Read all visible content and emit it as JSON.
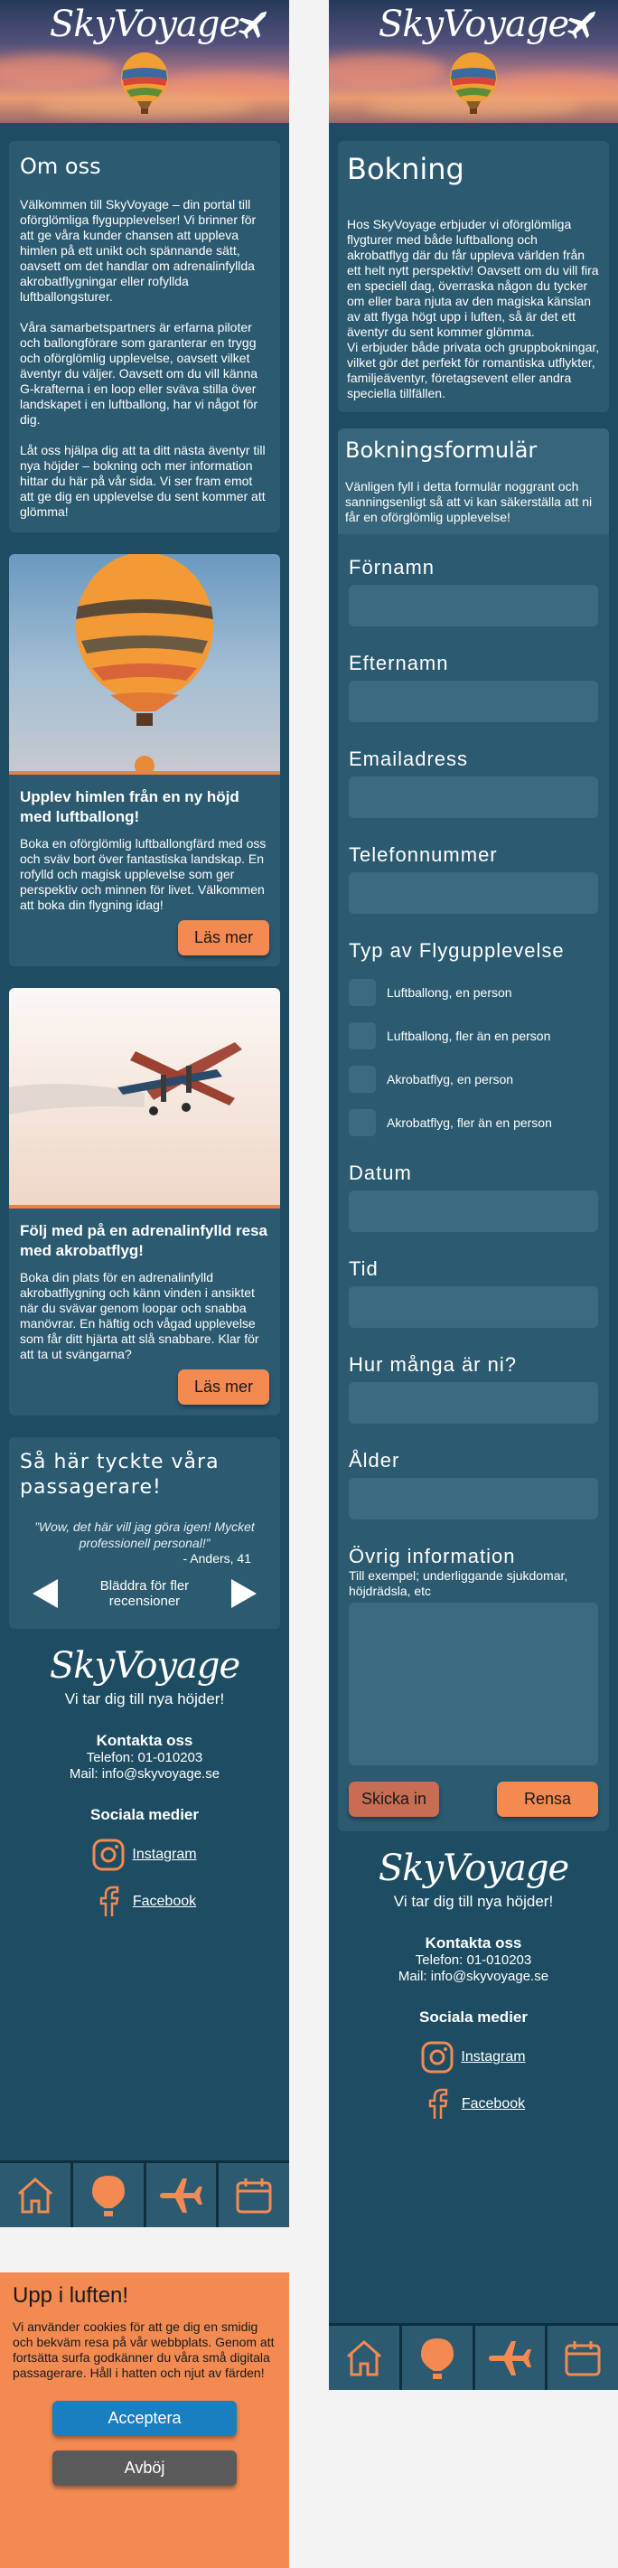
{
  "brand": {
    "logo": "SkyVoyage",
    "tagline": "Vi tar dig till nya höjder!"
  },
  "about": {
    "title": "Om oss",
    "p1": "Välkommen till SkyVoyage – din portal till oförglömliga flygupplevelser! Vi brinner för att ge våra kunder chansen att uppleva himlen på ett unikt och spännande sätt, oavsett om det handlar om adrenalinfyllda akrobatflygningar eller rofyllda luftballongsturer.",
    "p2": "Våra samarbetspartners är erfarna piloter och ballongförare som garanterar en trygg och oförglömlig upplevelse, oavsett vilket äventyr du väljer. Oavsett om du vill känna G-krafterna i en loop eller sväva stilla över landskapet i en luftballong, har vi något för dig.",
    "p3": "Låt oss hjälpa dig att ta ditt nästa äventyr till nya höjder – bokning och mer information hittar du här på vår sida. Vi ser fram emot att ge dig en upplevelse du sent kommer att glömma!"
  },
  "cards": [
    {
      "title": "Upplev himlen från en ny höjd med luftballong!",
      "text": "Boka en oförglömlig luftballongfärd med oss och sväv bort över fantastiska landskap. En rofylld och magisk upplevelse som ger perspektiv och minnen för livet. Välkommen att boka din flygning idag!",
      "button": "Läs mer"
    },
    {
      "title": "Följ med på en adrenalinfylld resa med akrobatflyg!",
      "text": "Boka din plats för en adrenalinfylld akrobatflygning och känn vinden i ansiktet när du svävar genom loopar och snabba manövrar. En häftig och vågad upplevelse som får ditt hjärta att slå snabbare. Klar för att ta ut svängarna?",
      "button": "Läs mer"
    }
  ],
  "reviews": {
    "title": "Så här tyckte våra passagerare!",
    "quote": "”Wow, det här vill jag göra igen! Mycket professionell personal!”",
    "author": "- Anders, 41",
    "nav_label": "Bläddra för fler recensioner"
  },
  "footer": {
    "contact_title": "Kontakta oss",
    "phone": "Telefon: 01-010203",
    "mail": "Mail: info@skyvoyage.se",
    "social_title": "Sociala medier",
    "instagram": "Instagram",
    "facebook": "Facebook"
  },
  "cookie": {
    "title": "Upp i luften!",
    "text": "Vi använder cookies för att ge dig en smidig och bekväm resa på vår webbplats. Genom att fortsätta surfa godkänner du våra små digitala passagerare. Håll i hatten och njut av färden!",
    "accept": "Acceptera",
    "decline": "Avböj"
  },
  "booking": {
    "title": "Bokning",
    "text": "Hos SkyVoyage erbjuder vi oförglömliga flygturer med både luftballong och akrobatflyg där du får uppleva världen från ett helt nytt perspektiv! Oavsett om du vill fira en speciell dag, överraska någon du tycker om eller bara njuta av den magiska känslan av att flyga högt upp i luften, så är det ett äventyr du sent kommer glömma.\nVi erbjuder både privata och gruppbokningar, vilket gör det perfekt för romantiska utflykter, familjeäventyr, företagsevent eller andra speciella tillfällen."
  },
  "form": {
    "title": "Bokningsformulär",
    "intro": "Vänligen fyll i detta formulär noggrant och sanningsenligt så att vi kan säkerställa att ni får en oförglömlig upplevelse!",
    "firstname": "Förnamn",
    "lastname": "Efternamn",
    "email": "Emailadress",
    "phone": "Telefonnummer",
    "type": "Typ av Flygupplevelse",
    "options": [
      "Luftballong, en person",
      "Luftballong, fler än en person",
      "Akrobatflyg, en person",
      "Akrobatflyg, fler än en person"
    ],
    "date": "Datum",
    "time": "Tid",
    "count": "Hur många är ni?",
    "age": "Ålder",
    "other": "Övrig information",
    "other_hint": "Till exempel; underliggande sjukdomar, höjdrädsla, etc",
    "submit": "Skicka in",
    "reset": "Rensa"
  },
  "colors": {
    "bg": "#1e4d63",
    "card": "#2c5a70",
    "accent": "#f28a52",
    "accept": "#1a7fc0",
    "decline": "#5a5a5a"
  },
  "icons": [
    "home-icon",
    "balloon-icon",
    "plane-icon",
    "calendar-icon",
    "instagram-icon",
    "facebook-icon"
  ]
}
